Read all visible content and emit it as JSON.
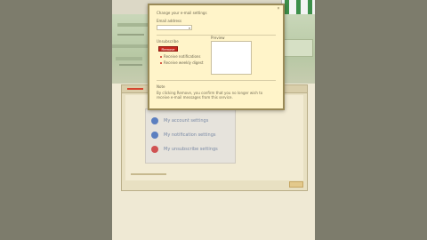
{
  "colors": {
    "outer_background": "#7d7c6c",
    "page_background": "#efe9d4",
    "dialog_background": "#fff4c9",
    "accent_red": "#c8281e",
    "logo_green": "#3d8f4a"
  },
  "header": {
    "logo_icon": "green-striped-logo-icon"
  },
  "dialog": {
    "title": "Change your e-mail settings",
    "close_icon": "close-icon",
    "close_glyph": "×",
    "select_label": "Email address",
    "select_value": "",
    "arrow_glyph": "▾",
    "section_label": "Unsubscribe",
    "button_label": "Remove",
    "preview_label": "Preview",
    "option_1": "Receive notifications",
    "option_2": "Receive weekly digest",
    "note_label": "Note",
    "acknowledgement": "By clicking Remove, you confirm that you no longer wish to receive e-mail messages from this service."
  },
  "main": {
    "frame_title": "Settings",
    "menu": [
      {
        "icon": "person-icon",
        "icon_color": "#5b7fc0",
        "label": "My account settings"
      },
      {
        "icon": "mail-icon",
        "icon_color": "#5b7fc0",
        "label": "My notification settings"
      },
      {
        "icon": "stop-icon",
        "icon_color": "#d05252",
        "label": "My unsubscribe settings"
      }
    ],
    "footer_button_icon": "next-icon"
  }
}
